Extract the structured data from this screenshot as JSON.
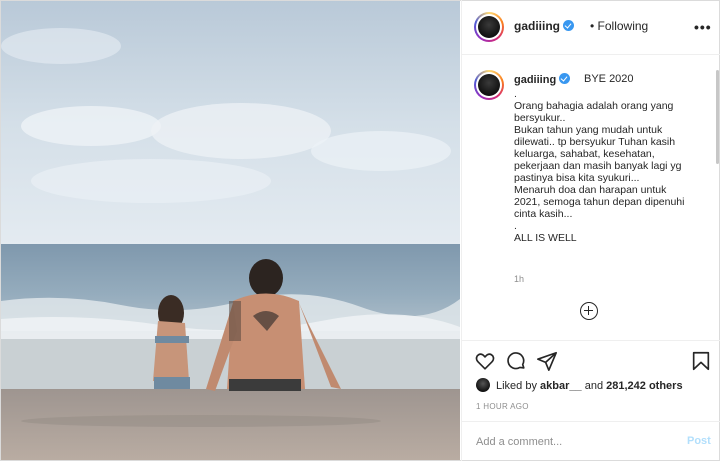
{
  "header": {
    "username": "gadiiing",
    "follow_status": "• Following",
    "more": "•••"
  },
  "caption": {
    "username": "gadiiing",
    "title": "BYE 2020",
    "lines": [
      ".",
      "Orang bahagia adalah orang yang",
      "bersyukur..",
      "Bukan tahun yang mudah untuk",
      "dilewati.. tp bersyukur Tuhan kasih",
      "keluarga, sahabat, kesehatan,",
      "pekerjaan dan masih banyak lagi yg",
      "pastinya bisa kita syukuri...",
      "Menaruh doa dan harapan untuk",
      "2021, semoga tahun depan dipenuhi",
      "cinta kasih...",
      ".",
      "ALL IS WELL"
    ],
    "time": "1h"
  },
  "likes": {
    "prefix": "Liked by",
    "user": "akbar__",
    "middle": "and",
    "count": "281,242 others"
  },
  "posted_ago": "1 HOUR AGO",
  "comment": {
    "placeholder": "Add a comment...",
    "post_label": "Post"
  },
  "icons": {
    "like": "heart-icon",
    "comment": "comment-icon",
    "share": "paper-plane-icon",
    "save": "bookmark-icon",
    "load_more": "plus-circle-icon",
    "verified": "verified-badge-icon"
  },
  "colors": {
    "verified": "#3897f0",
    "post_disabled": "#b2dffc",
    "muted": "#8e8e8e",
    "text": "#262626"
  }
}
